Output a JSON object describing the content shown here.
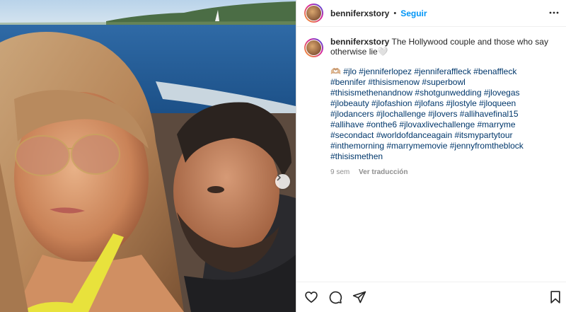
{
  "post": {
    "username": "benniferxstory",
    "separator": "•",
    "follow_label": "Seguir",
    "caption_text": "The Hollywood couple and those who say otherwise lie🤍",
    "hashtags": "🫶🏼 #jlo #jenniferlopez #jenniferaffleck #benaffleck #bennifer #thisismenow #superbowl #thisismethenandnow #shotgunwedding #jlovegas #jlobeauty #jlofashion #jlofans #jlostyle #jloqueen #jlodancers #jlochallenge #jlovers #allihavefinal15 #allihave #onthe6 #jlovaxlivechallenge #marryme #secondact #worldofdanceagain #itsmypartytour #inthemorning #marrymemovie #jennyfromtheblock #thisismethen",
    "age": "9 sem",
    "translate_label": "Ver traducción"
  },
  "icons": {
    "more": "more-horizontal-icon",
    "next": "chevron-right-icon",
    "like": "heart-icon",
    "comment": "comment-icon",
    "share": "send-icon",
    "save": "bookmark-icon"
  },
  "colors": {
    "link": "#0095f6",
    "hashtag": "#00376b",
    "meta": "#8e8e8e"
  }
}
